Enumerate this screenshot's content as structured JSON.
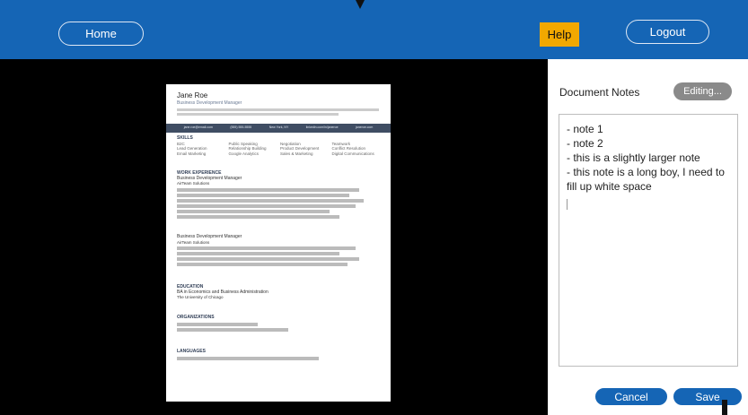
{
  "header": {
    "home_label": "Home",
    "help_label": "Help",
    "logout_label": "Logout",
    "colors": {
      "bar": "#1565b5",
      "help": "#f2a800"
    }
  },
  "document": {
    "name": "Jane Roe",
    "role": "Business Development Manager",
    "summary": "",
    "contact": [
      "jane.roe@email.com",
      "(555) 555-5555",
      "New York, NY",
      "linkedin.com/in/janeroe",
      "janeroe.com"
    ],
    "sections": {
      "skills": "SKILLS",
      "work": "WORK EXPERIENCE",
      "job1_title": "Business Development Manager",
      "job1_company": "AirTeam Solutions",
      "job2_title": "Business Development Manager",
      "job2_company": "AirTeam Solutions",
      "education": "EDUCATION",
      "degree": "BA in Economics and Business Administration",
      "school": "The University of Chicago",
      "organizations": "ORGANIZATIONS",
      "languages": "LANGUAGES"
    },
    "skills": [
      "B2C",
      "Public Speaking",
      "Negotiation",
      "Teamwork",
      "Lead Generation",
      "Relationship Building",
      "Product Development",
      "Conflict Resolution",
      "Email Marketing",
      "Google Analytics",
      "Sales & Marketing",
      "Digital Communications"
    ]
  },
  "notes": {
    "label": "Document Notes",
    "mode_button": "Editing...",
    "lines": [
      "- note 1",
      "- note 2",
      "- this is a slightly larger note",
      "- this note is a long boy, I need to fill up white space"
    ]
  },
  "actions": {
    "cancel_label": "Cancel",
    "save_label": "Save"
  }
}
